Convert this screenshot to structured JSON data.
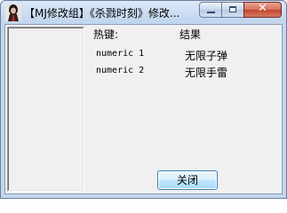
{
  "window": {
    "title": "【MJ修改组】《杀戮时刻》修改...",
    "close_glyph": "✕",
    "icon": "app-avatar-icon"
  },
  "table": {
    "header_hotkey": "热键:",
    "header_result": "结果",
    "rows": [
      {
        "key": "numeric 1",
        "value": "无限子弹"
      },
      {
        "key": "numeric 2",
        "value": "无限手雷"
      }
    ]
  },
  "buttons": {
    "close_label": "关闭"
  },
  "colors": {
    "title_bar": "#c3d6ef",
    "client_bg": "#f0f0f0",
    "close_button_red": "#c3452d"
  }
}
